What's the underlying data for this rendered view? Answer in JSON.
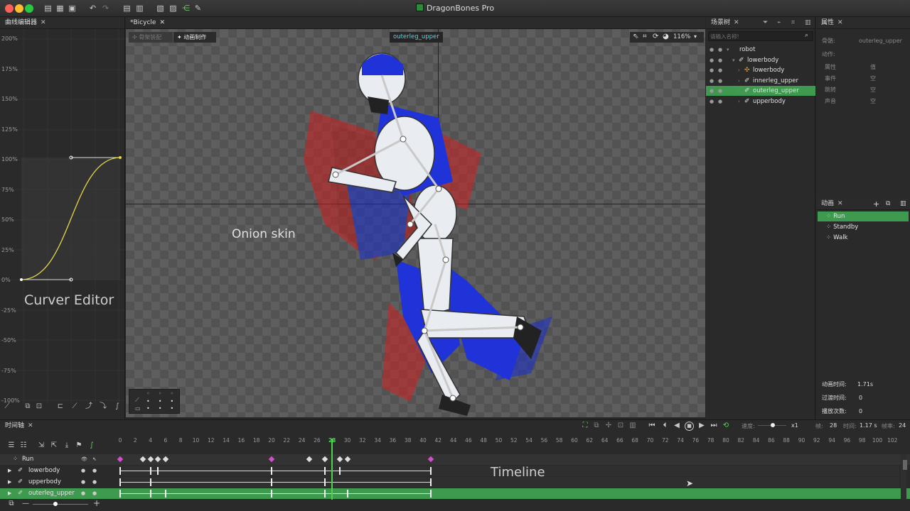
{
  "app": {
    "title": "DragonBones Pro",
    "traffic_colors": [
      "#fe5f57",
      "#febc2e",
      "#28c840"
    ]
  },
  "curve_editor": {
    "header": "曲线编辑器",
    "y_labels": [
      "200%",
      "175%",
      "150%",
      "125%",
      "100%",
      "75%",
      "50%",
      "25%",
      "0%",
      "-25%",
      "-50%",
      "-75%",
      "-100%"
    ],
    "overlay": "Curver Editor"
  },
  "viewport": {
    "tab": "*Bicycle",
    "mode_armature": "骨架装配",
    "mode_animate": "动画制作",
    "selected_bone": "outerleg_upper",
    "zoom": "116%",
    "overlay": "Onion skin"
  },
  "scene_tree": {
    "header": "场景树",
    "search_placeholder": "请输入名称!",
    "items": [
      {
        "label": "robot",
        "indent": 0,
        "icon": "armature"
      },
      {
        "label": "lowerbody",
        "indent": 1,
        "icon": "bone"
      },
      {
        "label": "lowerbody",
        "indent": 2,
        "icon": "slot"
      },
      {
        "label": "innerleg_upper",
        "indent": 2,
        "icon": "bone"
      },
      {
        "label": "outerleg_upper",
        "indent": 2,
        "icon": "bone",
        "selected": true
      },
      {
        "label": "upperbody",
        "indent": 2,
        "icon": "bone"
      }
    ]
  },
  "properties": {
    "header": "属性",
    "bone_label": "骨骼:",
    "bone_value": "outerleg_upper",
    "action_label": "动作:",
    "rows": [
      {
        "k": "属性",
        "v": "值"
      },
      {
        "k": "事件",
        "v": "空"
      },
      {
        "k": "跳转",
        "v": "空"
      },
      {
        "k": "声音",
        "v": "空"
      }
    ]
  },
  "animation_panel": {
    "header": "动画",
    "items": [
      "Run",
      "Standby",
      "Walk"
    ],
    "selected": "Run",
    "duration_label": "动画时间:",
    "duration": "1.71s",
    "transition_label": "过渡时间:",
    "transition": "0",
    "playtimes_label": "播放次数:",
    "playtimes": "0"
  },
  "timeline": {
    "header": "时间轴",
    "overlay": "Timeline",
    "speed_label": "速度:",
    "speed": "x1",
    "frame_label": "帧:",
    "frame": "28",
    "time_label": "时间:",
    "time": "1.17 s",
    "fps_label": "帧率:",
    "fps": "24",
    "current_frame": 28,
    "ticks": [
      0,
      2,
      4,
      6,
      8,
      10,
      12,
      14,
      16,
      18,
      20,
      22,
      24,
      26,
      28,
      30,
      32,
      34,
      36,
      38,
      40,
      42,
      44,
      46,
      48,
      50,
      52,
      54,
      56,
      58,
      60,
      62,
      64,
      66,
      68,
      70,
      72,
      74,
      76,
      78,
      80,
      82,
      84,
      86,
      88,
      90,
      92,
      94,
      96,
      98,
      100,
      102
    ],
    "tracks": [
      {
        "name": "Run",
        "keys": [
          0,
          3,
          4,
          5,
          6,
          20,
          25,
          27,
          29,
          30,
          41
        ]
      },
      {
        "name": "lowerbody",
        "keys": [
          0,
          4,
          5,
          20,
          27,
          29,
          41
        ]
      },
      {
        "name": "upperbody",
        "keys": [
          0,
          4,
          20,
          27,
          41
        ]
      },
      {
        "name": "outerleg_upper",
        "keys": [
          0,
          4,
          6,
          20,
          27,
          30,
          41
        ],
        "selected": true
      }
    ]
  },
  "colors": {
    "accent_green": "#3e9a4f",
    "playhead": "#4fd04f",
    "keyframe_pink": "#d24fd0"
  }
}
